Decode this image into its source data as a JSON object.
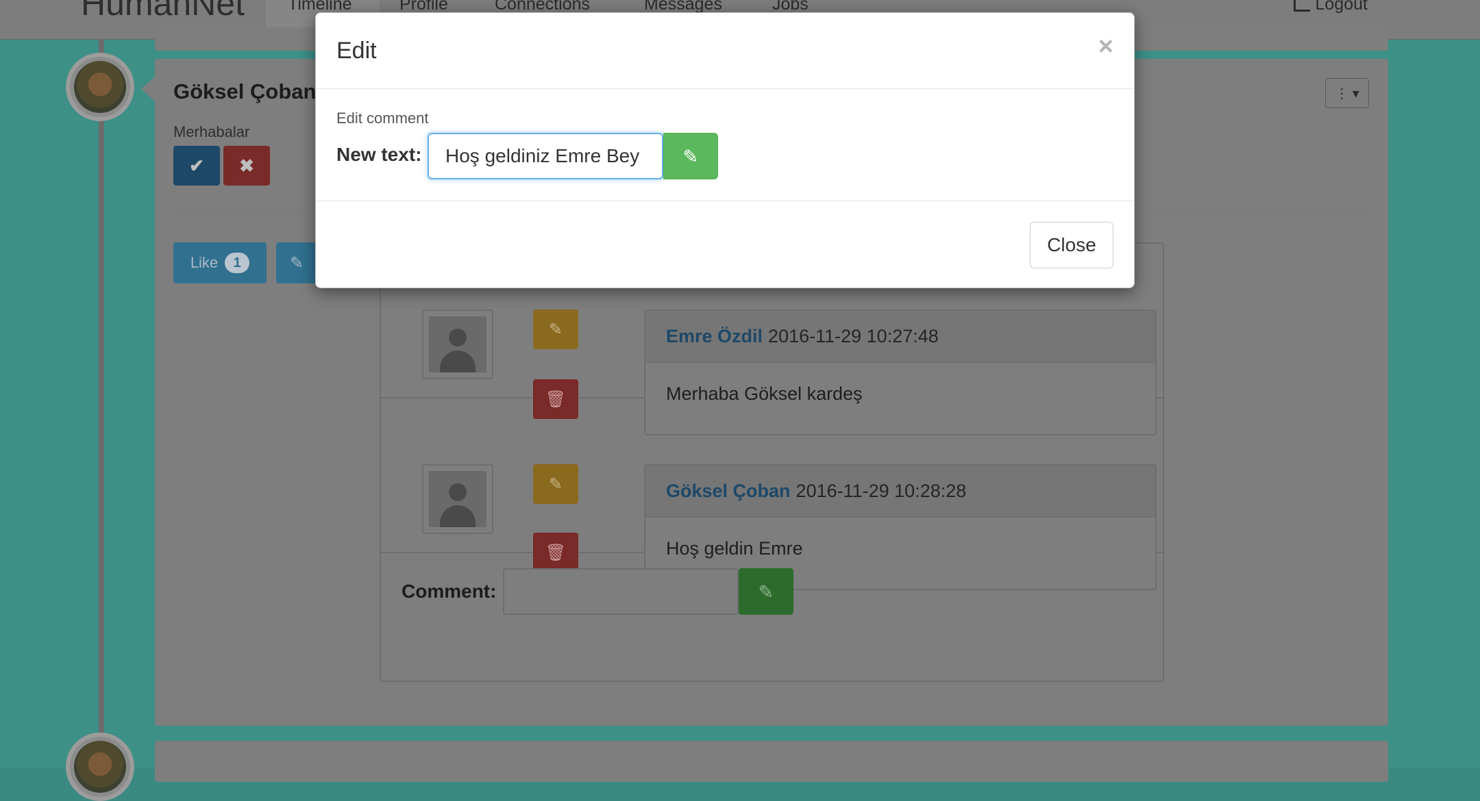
{
  "navbar": {
    "brand": "HumanNet",
    "items": [
      "Timeline",
      "Profile",
      "Connections",
      "Messages",
      "Jobs"
    ],
    "logout": "Logout"
  },
  "post": {
    "author": "Göksel Çoban",
    "text": "Merhabalar",
    "like_label": "Like",
    "like_count": "1"
  },
  "comments": [
    {
      "author": "Emre Özdil",
      "date": "2016-11-29 10:27:48",
      "text": "Merhaba Göksel kardeş"
    },
    {
      "author": "Göksel Çoban",
      "date": "2016-11-29 10:28:28",
      "text": "Hoş geldin Emre"
    }
  ],
  "comment_form": {
    "label": "Comment:",
    "value": ""
  },
  "modal": {
    "title": "Edit",
    "close_x": "×",
    "subtitle": "Edit comment",
    "label": "New text:",
    "input_value": "Hoş geldiniz Emre Bey",
    "close_button": "Close"
  },
  "colors": {
    "accent_green": "#5cb85c",
    "focus_blue": "#66afe9",
    "link_blue": "#337ab7",
    "teal_bg": "#3c9086"
  }
}
